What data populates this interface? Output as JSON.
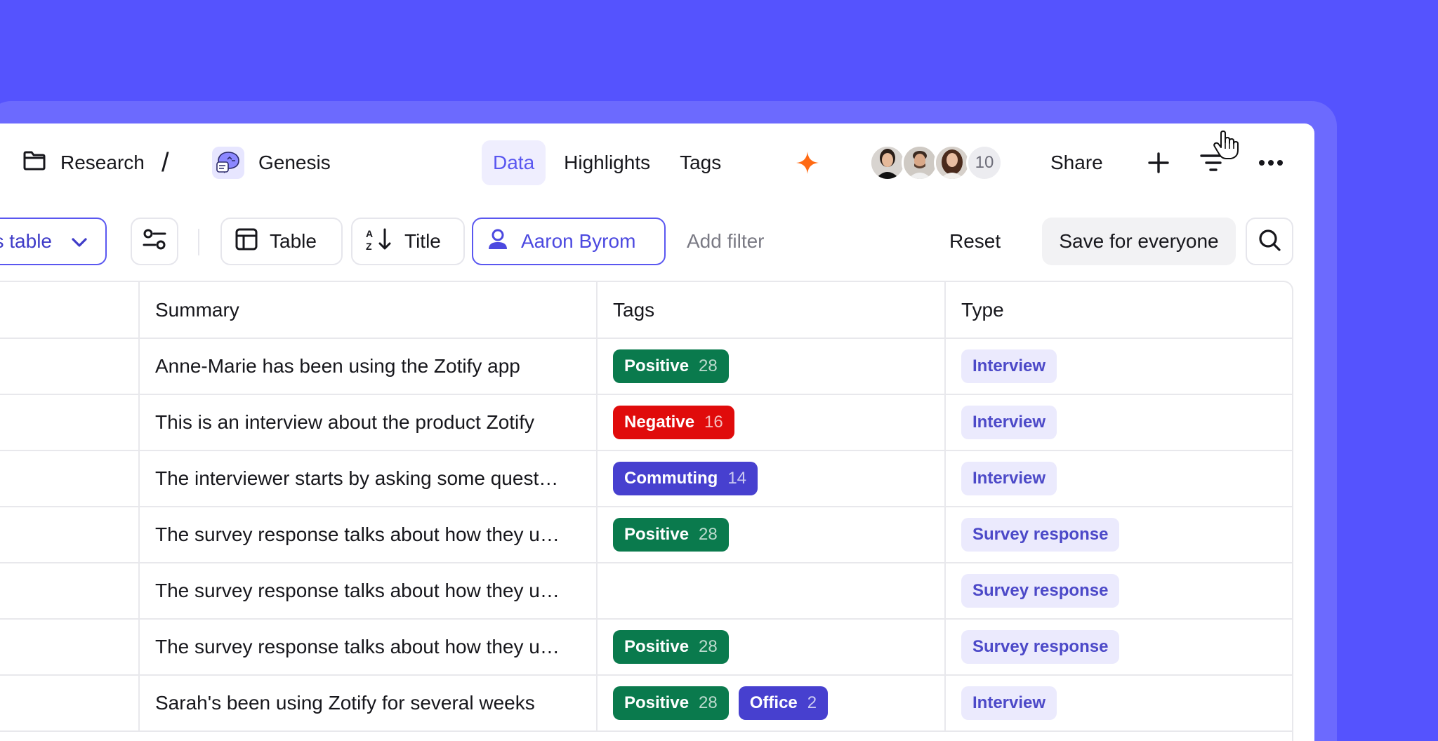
{
  "breadcrumb": {
    "folder": "Research",
    "separator": "/",
    "project": "Genesis"
  },
  "tabs": [
    {
      "label": "Data",
      "active": true
    },
    {
      "label": "Highlights",
      "active": false
    },
    {
      "label": "Tags",
      "active": false
    }
  ],
  "collaborators": {
    "extra_count": "10"
  },
  "header_actions": {
    "share": "Share"
  },
  "toolbar": {
    "view_label": "s table",
    "layout_label": "Table",
    "sort_label": "Title",
    "person_filter": "Aaron Byrom",
    "add_filter": "Add filter",
    "reset": "Reset",
    "save": "Save for everyone"
  },
  "table": {
    "columns": [
      "",
      "Summary",
      "Tags",
      "Type"
    ],
    "rows": [
      {
        "summary": "Anne-Marie has been using the Zotify app",
        "tags": [
          {
            "name": "Positive",
            "count": "28",
            "color": "#0a7a4d"
          }
        ],
        "type": "Interview"
      },
      {
        "summary": "This is an interview about the product Zotify",
        "tags": [
          {
            "name": "Negative",
            "count": "16",
            "color": "#e00b0b"
          }
        ],
        "type": "Interview"
      },
      {
        "summary": "The interviewer starts by asking some quest…",
        "tags": [
          {
            "name": "Commuting",
            "count": "14",
            "color": "#4740cf"
          }
        ],
        "type": "Interview"
      },
      {
        "summary": "The survey response talks about how they u…",
        "tags": [
          {
            "name": "Positive",
            "count": "28",
            "color": "#0a7a4d"
          }
        ],
        "type": "Survey response"
      },
      {
        "summary": "The survey response talks about how they u…",
        "tags": [],
        "type": "Survey response"
      },
      {
        "summary": "The survey response talks about how they u…",
        "tags": [
          {
            "name": "Positive",
            "count": "28",
            "color": "#0a7a4d"
          }
        ],
        "type": "Survey response"
      },
      {
        "summary": "Sarah's been using Zotify for several weeks",
        "tags": [
          {
            "name": "Positive",
            "count": "28",
            "color": "#0a7a4d"
          },
          {
            "name": "Office",
            "count": "2",
            "color": "#4740cf"
          }
        ],
        "type": "Interview"
      }
    ]
  },
  "colors": {
    "background": "#5553fe",
    "accent": "#5a57f0",
    "spark": "#ff6a13"
  },
  "icons": [
    "folder-icon",
    "genesis-icon",
    "sparkle-icon",
    "plus-icon",
    "filter-icon",
    "more-icon",
    "chevron-down-icon",
    "sliders-icon",
    "table-icon",
    "sort-az-icon",
    "person-icon",
    "search-icon",
    "hand-cursor-icon"
  ]
}
